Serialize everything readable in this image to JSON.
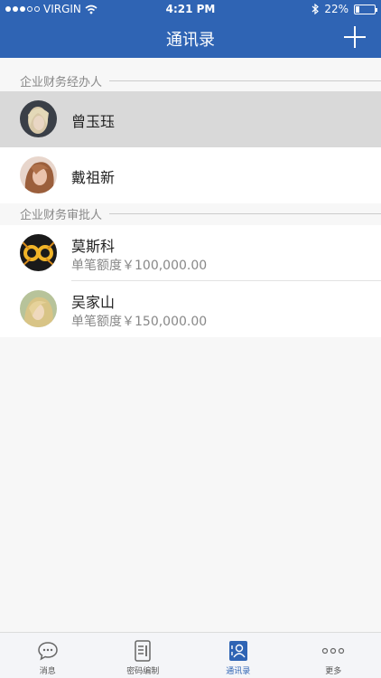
{
  "status_bar": {
    "carrier": "VIRGIN",
    "time": "4:21 PM",
    "battery": "22%",
    "battery_level": 0.22
  },
  "nav": {
    "title": "通讯录"
  },
  "sections": [
    {
      "header": "企业财务经办人",
      "contacts": [
        {
          "name": "曾玉珏",
          "selected": true
        },
        {
          "name": "戴祖新"
        }
      ]
    },
    {
      "header": "企业财务审批人",
      "contacts": [
        {
          "name": "莫斯科",
          "quota": "单笔额度￥100,000.00"
        },
        {
          "name": "吴家山",
          "quota": "单笔额度￥150,000.00"
        }
      ]
    }
  ],
  "tabs": [
    {
      "label": "消息",
      "icon": "chat-bubble-icon"
    },
    {
      "label": "密码编制",
      "icon": "document-icon"
    },
    {
      "label": "通讯录",
      "icon": "contacts-icon",
      "active": true
    },
    {
      "label": "更多",
      "icon": "more-dots-icon"
    }
  ],
  "colors": {
    "primary": "#2f64b4",
    "selected_row": "#d9d9d9",
    "background": "#f7f7f7"
  }
}
